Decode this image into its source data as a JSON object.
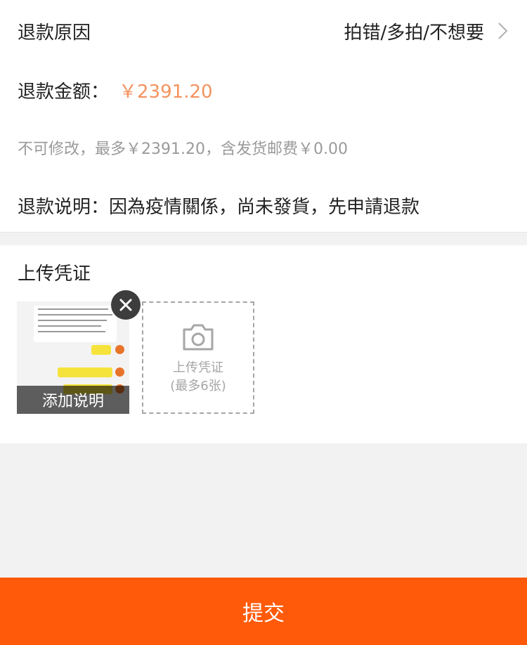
{
  "refund_reason": {
    "label": "退款原因",
    "value": "拍错/多拍/不想要"
  },
  "refund_amount": {
    "label": "退款金额：",
    "value": "￥2391.20"
  },
  "amount_note": "不可修改，最多￥2391.20，含发货邮费￥0.00",
  "refund_desc": {
    "text": "退款说明：因為疫情關係，尚未發貨，先申請退款"
  },
  "upload": {
    "title": "上传凭证",
    "thumb_caption": "添加说明",
    "box_label": "上传凭证",
    "box_hint": "(最多6张)",
    "max": 6
  },
  "submit_label": "提交",
  "colors": {
    "accent": "#ff5a0a",
    "amount": "#f4935f"
  },
  "icons": [
    "chevron-right-icon",
    "close-icon",
    "camera-icon"
  ]
}
